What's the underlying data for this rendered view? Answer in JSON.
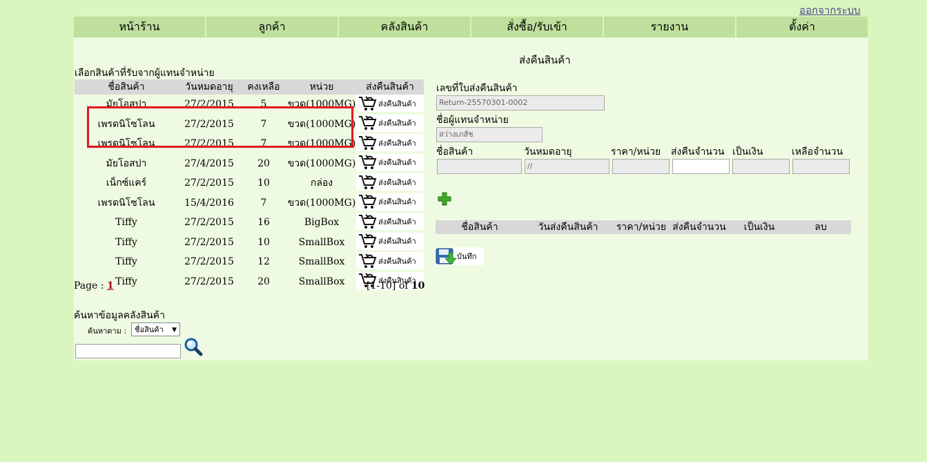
{
  "logout_label": "ออกจากระบบ",
  "nav": [
    "หน้าร้าน",
    "ลูกค้า",
    "คลังสินค้า",
    "สั่งซื้อ/รับเข้า",
    "รายงาน",
    "ตั้งค่า"
  ],
  "page_title": "ส่งคืนสินค้า",
  "stock": {
    "section_title": "เลือกสินค้าที่รับจากผู้แทนจำหน่าย",
    "headers": [
      "ชื่อสินค้า",
      "วันหมดอายุ",
      "คงเหลือ",
      "หน่วย",
      "ส่งคืนสินค้า"
    ],
    "return_label": "ส่งคืนสินค้า",
    "rows": [
      [
        "มัยโอสปา",
        "27/2/2015",
        "5",
        "ขวด(1000MG)"
      ],
      [
        "เพรดนิโซโลน",
        "27/2/2015",
        "7",
        "ขวด(1000MG)"
      ],
      [
        "เพรดนิโซโลน",
        "27/2/2015",
        "7",
        "ขวด(1000MG)"
      ],
      [
        "มัยโอสปา",
        "27/4/2015",
        "20",
        "ขวด(1000MG)"
      ],
      [
        "เน็กซ์แคร์",
        "27/2/2015",
        "10",
        "กล่อง"
      ],
      [
        "เพรดนิโซโลน",
        "15/4/2016",
        "7",
        "ขวด(1000MG)"
      ],
      [
        "Tiffy",
        "27/2/2015",
        "16",
        "BigBox"
      ],
      [
        "Tiffy",
        "27/2/2015",
        "10",
        "SmallBox"
      ],
      [
        "Tiffy",
        "27/2/2015",
        "12",
        "SmallBox"
      ],
      [
        "Tiffy",
        "27/2/2015",
        "20",
        "SmallBox"
      ]
    ]
  },
  "pagination": {
    "page_label": "Page :",
    "current_page": "1",
    "range": "[1-10] of",
    "total": "10"
  },
  "search": {
    "title": "ค้นหาข้อมูลคลังสินค้า",
    "by_label": "ค้นหาตาม :",
    "selected": "ชื่อสินค้า",
    "value": ""
  },
  "form": {
    "doc_no_label": "เลขที่ใบส่งคืนสินค้า",
    "doc_no": "Return-25570301-0002",
    "supplier_label": "ชื่อผู้แทนจำหน่าย",
    "supplier": "สว่างเภสัช",
    "col_labels": [
      "ชื่อสินค้า",
      "วันหมดอายุ",
      "ราคา/หน่วย",
      "ส่งคืนจำนวน",
      "เป็นเงิน",
      "เหลือจำนวน"
    ],
    "expiry_value": "//",
    "return_table_headers": [
      "ชื่อสินค้า",
      "วันส่งคืนสินค้า",
      "ราคา/หน่วย",
      "ส่งคืนจำนวน",
      "เป็นเงิน",
      "ลบ"
    ],
    "save_label": "บันทึก"
  }
}
